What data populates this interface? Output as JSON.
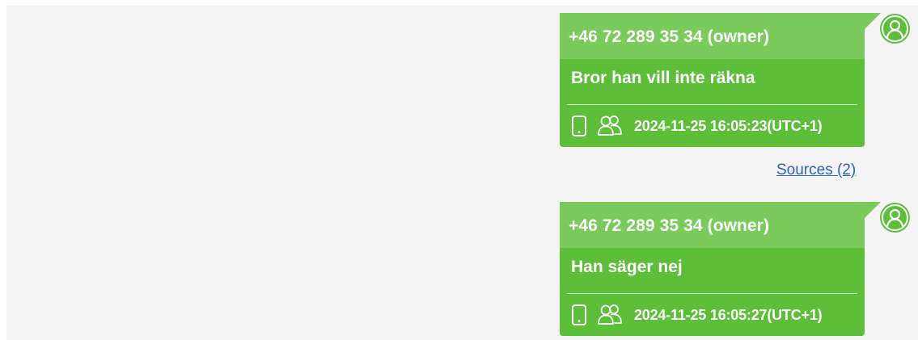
{
  "messages": [
    {
      "sender": "+46 72 289 35 34 (owner)",
      "text": "Bror han vill inte räkna",
      "timestamp": "2024-11-25 16:05:23(UTC+1)"
    },
    {
      "sender": "+46 72 289 35 34 (owner)",
      "text": "Han säger nej",
      "timestamp": "2024-11-25 16:05:27(UTC+1)"
    }
  ],
  "sources": {
    "label": "Sources (2)"
  },
  "icons": {
    "phone": "phone-icon",
    "group": "group-icon",
    "avatar": "user-avatar-icon"
  },
  "colors": {
    "background": "#f4f4f4",
    "bubble": "#5dbe3a",
    "bubble_header": "#7acb5c",
    "avatar": "#5dbe3a",
    "link": "#2b63c5"
  }
}
